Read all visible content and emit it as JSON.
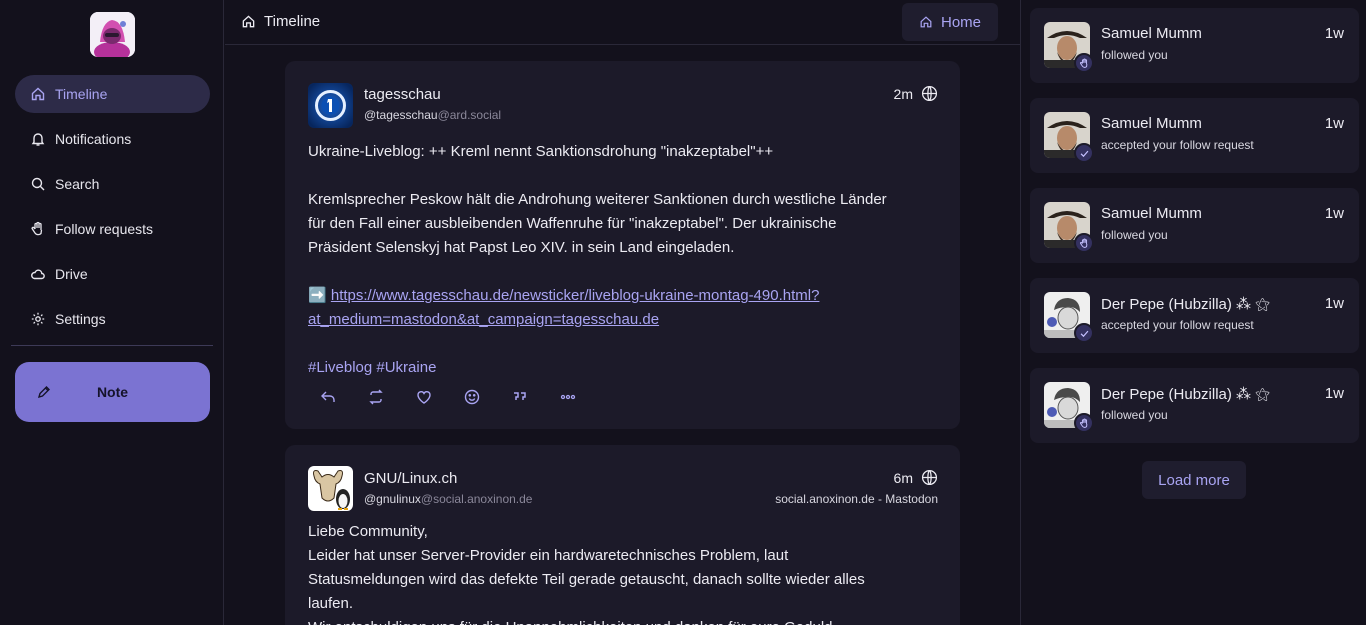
{
  "sidebar": {
    "items": [
      {
        "label": "Timeline",
        "icon": "home-icon"
      },
      {
        "label": "Notifications",
        "icon": "bell-icon"
      },
      {
        "label": "Search",
        "icon": "search-icon"
      },
      {
        "label": "Follow requests",
        "icon": "hand-wave-icon"
      },
      {
        "label": "Drive",
        "icon": "cloud-icon"
      },
      {
        "label": "Settings",
        "icon": "gear-icon"
      }
    ],
    "note_label": "Note"
  },
  "header": {
    "title": "Timeline",
    "home_label": "Home"
  },
  "posts": [
    {
      "name": "tagesschau",
      "handle_user": "@tagesschau",
      "handle_host": "@ard.social",
      "time": "2m",
      "instance": "",
      "line1": "Ukraine-Liveblog: ++ Kreml nennt Sanktionsdrohung \"inakzeptabel\"++",
      "para_l1": "Kremlsprecher Peskow hält die Androhung weiterer Sanktionen durch westliche Länder",
      "para_l2": "für den Fall einer ausbleibenden Waffenruhe für \"inakzeptabel\". Der ukrainische",
      "para_l3": "Präsident Selenskyj hat Papst Leo XIV. in sein Land eingeladen.",
      "link_prefix": "➡️ ",
      "link_l1": "https://www.tagesschau.de/newsticker/liveblog-ukraine-montag-490.html?",
      "link_l2": "at_medium=mastodon&at_campaign=tagesschau.de",
      "tags": "#Liveblog #Ukraine"
    },
    {
      "name": "GNU/Linux.ch",
      "handle_user": "@gnulinux",
      "handle_host": "@social.anoxinon.de",
      "time": "6m",
      "instance": "social.anoxinon.de - Mastodon",
      "b1": "Liebe Community,",
      "b2": "Leider hat unser Server-Provider ein hardwaretechnisches Problem, laut",
      "b3": "Statusmeldungen wird das defekte Teil gerade getauscht, danach sollte wieder alles",
      "b4": "laufen.",
      "b5": "Wir entschuldigen uns für die Unannehmlichkeiten und danken für eure Geduld."
    }
  ],
  "notifications": [
    {
      "name": "Samuel Mumm",
      "text": "followed you",
      "time": "1w",
      "badge": "hand-wave-icon"
    },
    {
      "name": "Samuel Mumm",
      "text": "accepted your follow request",
      "time": "1w",
      "badge": "check-icon"
    },
    {
      "name": "Samuel Mumm",
      "text": "followed you",
      "time": "1w",
      "badge": "hand-wave-icon"
    },
    {
      "name": "Der Pepe (Hubzilla) ⁂ ⚝",
      "text": "accepted your follow request",
      "time": "1w",
      "badge": "check-icon"
    },
    {
      "name": "Der Pepe (Hubzilla) ⁂ ⚝",
      "text": "followed you",
      "time": "1w",
      "badge": "hand-wave-icon"
    }
  ],
  "load_more_label": "Load more",
  "colors": {
    "accent": "#a9a4f2",
    "note_button": "#7b73d2",
    "background": "#13111c",
    "card": "#1c1a29"
  }
}
